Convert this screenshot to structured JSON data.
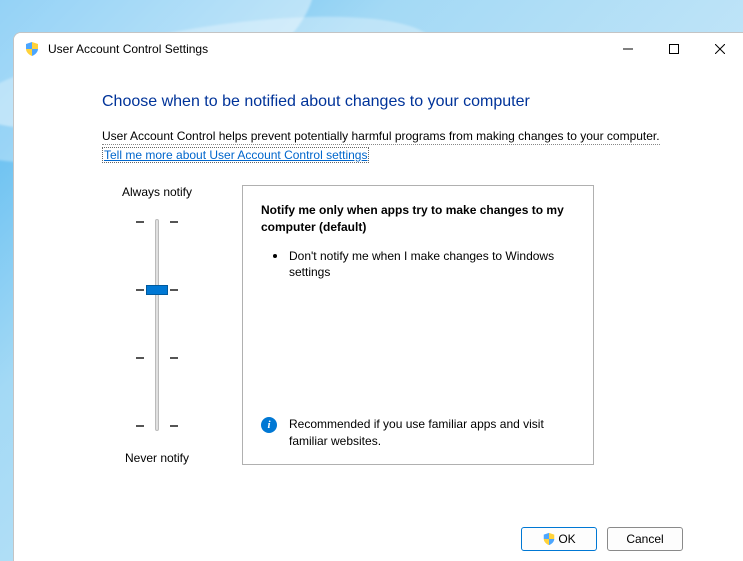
{
  "window": {
    "title": "User Account Control Settings"
  },
  "heading": "Choose when to be notified about changes to your computer",
  "description": "User Account Control helps prevent potentially harmful programs from making changes to your computer.",
  "help_link": "Tell me more about User Account Control settings",
  "slider": {
    "top_label": "Always notify",
    "bottom_label": "Never notify",
    "levels": 4,
    "current_level": 2
  },
  "panel": {
    "title": "Notify me only when apps try to make changes to my computer (default)",
    "bullets": [
      "Don't notify me when I make changes to Windows settings"
    ],
    "recommendation": "Recommended if you use familiar apps and visit familiar websites."
  },
  "buttons": {
    "ok": "OK",
    "cancel": "Cancel"
  }
}
